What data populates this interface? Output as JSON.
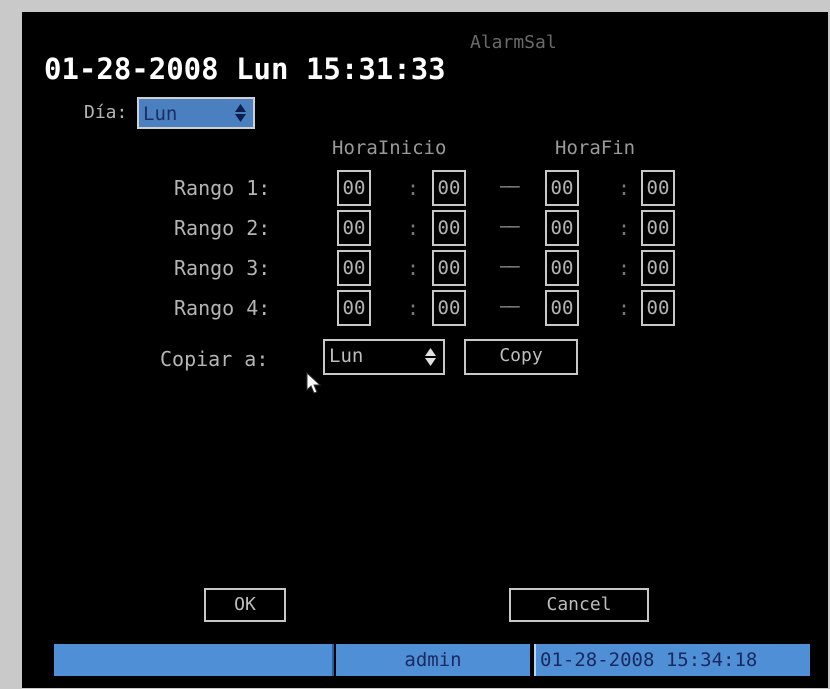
{
  "osd": {
    "date": "01-28-2008",
    "day": "Lun",
    "time": "15:31:33",
    "menu_title": "AlarmSal"
  },
  "day_select": {
    "label": "Día:",
    "value": "Lun"
  },
  "headers": {
    "start": "HoraInicio",
    "end": "HoraFin"
  },
  "ranges": [
    {
      "label": "Rango 1:",
      "start_h": "00",
      "start_m": "00",
      "end_h": "00",
      "end_m": "00"
    },
    {
      "label": "Rango 2:",
      "start_h": "00",
      "start_m": "00",
      "end_h": "00",
      "end_m": "00"
    },
    {
      "label": "Rango 3:",
      "start_h": "00",
      "start_m": "00",
      "end_h": "00",
      "end_m": "00"
    },
    {
      "label": "Rango 4:",
      "start_h": "00",
      "start_m": "00",
      "end_h": "00",
      "end_m": "00"
    }
  ],
  "separators": {
    "colon": ":",
    "dash": "——"
  },
  "copy": {
    "label": "Copiar a:",
    "value": "Lun",
    "button": "Copy"
  },
  "buttons": {
    "ok": "OK",
    "cancel": "Cancel"
  },
  "status_bar": {
    "user": "admin",
    "datetime": "01-28-2008 15:34:18"
  },
  "colors": {
    "status_blue": "#4f8fd6",
    "status_text": "#1a2a60",
    "screen": "#000000"
  }
}
